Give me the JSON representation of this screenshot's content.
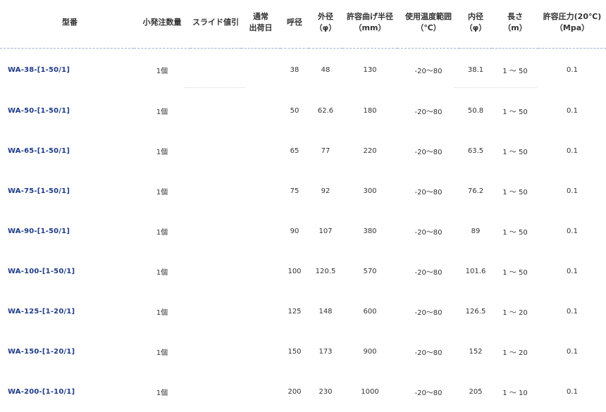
{
  "headers": {
    "model": "型番",
    "min_order": "小発注数量",
    "slide": "スライド値引",
    "ship_line1": "通常",
    "ship_line2": "出荷日",
    "nominal": "呼径",
    "outer_line1": "外径",
    "outer_line2": "（φ）",
    "bend_line1": "許容曲げ半径",
    "bend_line2": "（mm）",
    "temp_line1": "使用温度範囲",
    "temp_line2": "（℃）",
    "inner_line1": "内径",
    "inner_line2": "（φ）",
    "length_line1": "長さ",
    "length_line2": "（m）",
    "pressure_line1": "許容圧力(20℃)",
    "pressure_line2": "（Mpa）"
  },
  "rows": [
    {
      "model": "WA-38-[1-50/1]",
      "min_order": "1個",
      "slide": "",
      "ship": "",
      "nominal": "38",
      "outer": "48",
      "bend": "130",
      "temp": "-20～80",
      "inner": "38.1",
      "length": "1 ～ 50",
      "pressure": "0.1"
    },
    {
      "model": "WA-50-[1-50/1]",
      "min_order": "1個",
      "slide": "",
      "ship": "",
      "nominal": "50",
      "outer": "62.6",
      "bend": "180",
      "temp": "-20～80",
      "inner": "50.8",
      "length": "1 ～ 50",
      "pressure": "0.1"
    },
    {
      "model": "WA-65-[1-50/1]",
      "min_order": "1個",
      "slide": "",
      "ship": "",
      "nominal": "65",
      "outer": "77",
      "bend": "220",
      "temp": "-20～80",
      "inner": "63.5",
      "length": "1 ～ 50",
      "pressure": "0.1"
    },
    {
      "model": "WA-75-[1-50/1]",
      "min_order": "1個",
      "slide": "",
      "ship": "",
      "nominal": "75",
      "outer": "92",
      "bend": "300",
      "temp": "-20～80",
      "inner": "76.2",
      "length": "1 ～ 50",
      "pressure": "0.1"
    },
    {
      "model": "WA-90-[1-50/1]",
      "min_order": "1個",
      "slide": "",
      "ship": "",
      "nominal": "90",
      "outer": "107",
      "bend": "380",
      "temp": "-20～80",
      "inner": "89",
      "length": "1 ～ 50",
      "pressure": "0.1"
    },
    {
      "model": "WA-100-[1-50/1]",
      "min_order": "1個",
      "slide": "",
      "ship": "",
      "nominal": "100",
      "outer": "120.5",
      "bend": "570",
      "temp": "-20～80",
      "inner": "101.6",
      "length": "1 ～ 50",
      "pressure": "0.1"
    },
    {
      "model": "WA-125-[1-20/1]",
      "min_order": "1個",
      "slide": "",
      "ship": "",
      "nominal": "125",
      "outer": "148",
      "bend": "600",
      "temp": "-20～80",
      "inner": "126.5",
      "length": "1 ～ 20",
      "pressure": "0.1"
    },
    {
      "model": "WA-150-[1-20/1]",
      "min_order": "1個",
      "slide": "",
      "ship": "",
      "nominal": "150",
      "outer": "173",
      "bend": "900",
      "temp": "-20～80",
      "inner": "152",
      "length": "1 ～ 20",
      "pressure": "0.1"
    },
    {
      "model": "WA-200-[1-10/1]",
      "min_order": "1個",
      "slide": "",
      "ship": "",
      "nominal": "200",
      "outer": "230",
      "bend": "1000",
      "temp": "-20～80",
      "inner": "205",
      "length": "1 ～ 10",
      "pressure": "0.1"
    }
  ]
}
